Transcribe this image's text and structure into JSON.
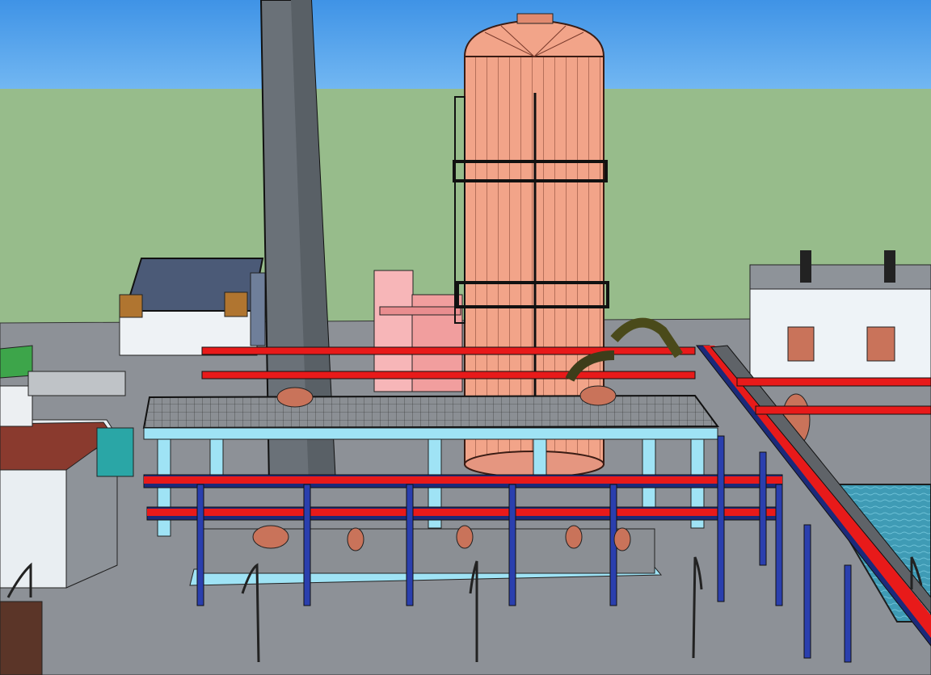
{
  "scene": {
    "kind": "3d-render",
    "colors": {
      "sky": "#5aa8f0",
      "sky_top": "#3f93e6",
      "grass": "#97bc8b",
      "ground": "#8d9197",
      "tower": "#f2a489",
      "tower_dark": "#c9775d",
      "chimney": "#6a7178",
      "pipe_red": "#e81a1a",
      "pipe_dark": "#1b2a7a",
      "support_blue": "#2a3fae",
      "platform_cyan": "#9fe3f5",
      "platform_grey": "#7f8388",
      "pink_building": "#f7b6b8",
      "roof_slate": "#4b5a77",
      "roof_brown": "#8a3a2e",
      "water": "#3f9bb5",
      "wall_white": "#e9eef2",
      "equipment_copper": "#c9735a"
    }
  }
}
